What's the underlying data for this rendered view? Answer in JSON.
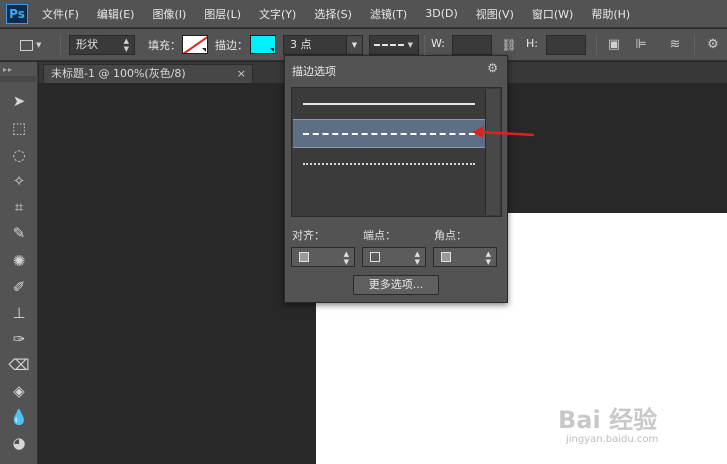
{
  "app": {
    "logo": "Ps"
  },
  "menu": [
    "文件(F)",
    "编辑(E)",
    "图像(I)",
    "图层(L)",
    "文字(Y)",
    "选择(S)",
    "滤镜(T)",
    "3D(D)",
    "视图(V)",
    "窗口(W)",
    "帮助(H)"
  ],
  "options_bar": {
    "mode": "形状",
    "fill_label": "填充：",
    "stroke_label": "描边：",
    "stroke_size": "3 点",
    "width_label": "W:",
    "height_label": "H:",
    "colors": {
      "fill": "#ffffff",
      "stroke": "#00f0ff"
    }
  },
  "document_tab": {
    "title": "未标题-1 @ 100%(灰色/8)",
    "close": "×"
  },
  "stroke_popup": {
    "title": "描边选项",
    "styles": [
      {
        "name": "solid",
        "selected": false
      },
      {
        "name": "dashed",
        "selected": true
      },
      {
        "name": "dotted",
        "selected": false
      }
    ],
    "align_label": "对齐：",
    "caps_label": "端点：",
    "corners_label": "角点：",
    "more_button": "更多选项..."
  },
  "watermark": {
    "brand": "Bai 经验",
    "url": "jingyan.baidu.com"
  },
  "annotation": {
    "arrow_color": "#e02020"
  }
}
